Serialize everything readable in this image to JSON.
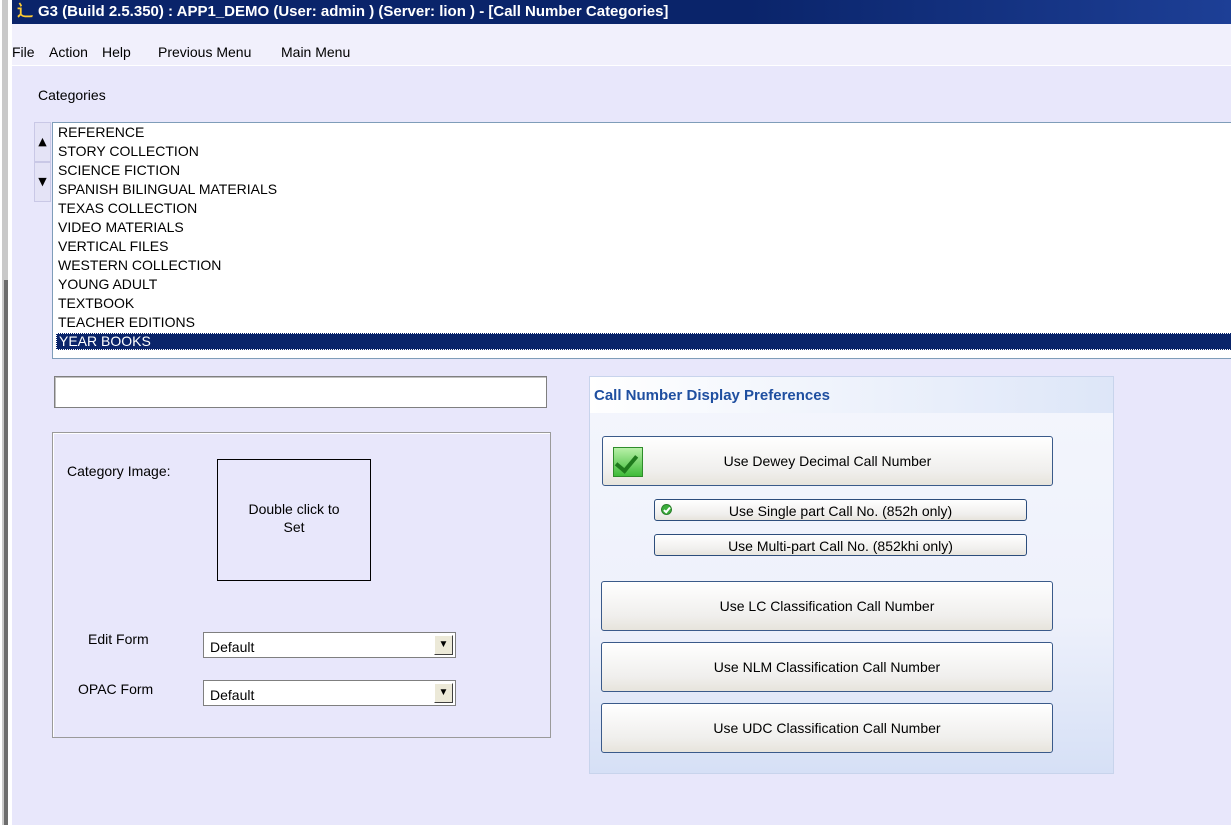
{
  "window": {
    "title": "G3 (Build 2.5.350) : APP1_DEMO (User: admin ) (Server: lion ) - [Call Number Categories]"
  },
  "menu": {
    "file": "File",
    "action": "Action",
    "help": "Help",
    "previous_menu": "Previous Menu",
    "main_menu": "Main Menu"
  },
  "categories": {
    "label": "Categories",
    "items": [
      "REFERENCE",
      "STORY COLLECTION",
      "SCIENCE FICTION",
      "SPANISH BILINGUAL MATERIALS",
      "TEXAS COLLECTION",
      "VIDEO MATERIALS",
      "VERTICAL FILES",
      "WESTERN COLLECTION",
      "YOUNG ADULT",
      "TEXTBOOK",
      "TEACHER EDITIONS",
      "YEAR BOOKS"
    ],
    "selected": "YEAR BOOKS",
    "name_value": ""
  },
  "category_image": {
    "label": "Category Image:",
    "placeholder_line1": "Double click to",
    "placeholder_line2": "Set"
  },
  "forms": {
    "edit_label": "Edit Form",
    "edit_value": "Default",
    "opac_label": "OPAC Form",
    "opac_value": "Default"
  },
  "preferences": {
    "heading": "Call Number Display Preferences",
    "dewey": "Use Dewey Decimal Call Number",
    "single_part": "Use Single part Call No. (852h only)",
    "multi_part": "Use Multi-part Call No. (852khi only)",
    "lc": "Use LC Classification Call Number",
    "nlm": "Use NLM Classification Call Number",
    "udc": "Use UDC Classification Call Number"
  },
  "icons": {
    "app": "app-logo-icon",
    "scroll_up": "scroll-up-icon",
    "scroll_down": "scroll-down-icon",
    "dropdown": "chevron-down-icon",
    "dewey_checked": "check-icon",
    "single_part_checked": "check-circle-icon"
  },
  "colors": {
    "title_bar": "#0a246a",
    "window_bg": "#e8e7fb",
    "selection": "#0a246a",
    "preferences_heading": "#1f4fa0",
    "check_green": "#3fbb39"
  }
}
